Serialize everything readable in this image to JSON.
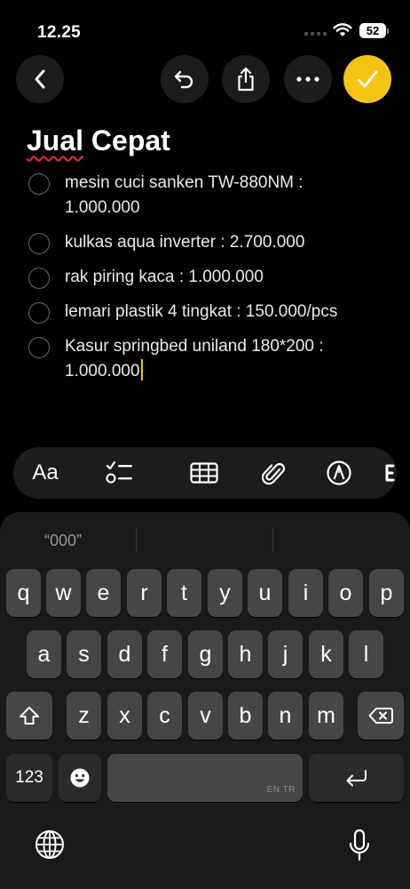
{
  "status": {
    "time": "12.25",
    "battery": "52"
  },
  "note": {
    "title_part1": "Jual",
    "title_part2": " Cepat",
    "items": [
      {
        "line1": "mesin cuci sanken TW-880NM :",
        "line2": "1.000.000"
      },
      {
        "line1": "kulkas aqua inverter : 2.700.000",
        "line2": ""
      },
      {
        "line1": "rak piring kaca : 1.000.000",
        "line2": ""
      },
      {
        "line1": "lemari plastik 4 tingkat : 150.000/pcs",
        "line2": ""
      },
      {
        "line1": "Kasur springbed uniland 180*200 :",
        "line2": "1.000.000"
      }
    ]
  },
  "format_bar": {
    "text_style": "Aa"
  },
  "keyboard": {
    "prediction": "“000”",
    "row1": [
      "q",
      "w",
      "e",
      "r",
      "t",
      "y",
      "u",
      "i",
      "o",
      "p"
    ],
    "row2": [
      "a",
      "s",
      "d",
      "f",
      "g",
      "h",
      "j",
      "k",
      "l"
    ],
    "row3": [
      "z",
      "x",
      "c",
      "v",
      "b",
      "n",
      "m"
    ],
    "numbers_label": "123",
    "space_lang": "EN TR"
  },
  "colors": {
    "accent": "#f5c314",
    "spellcheck": "#e0352b",
    "background": "#000000"
  }
}
